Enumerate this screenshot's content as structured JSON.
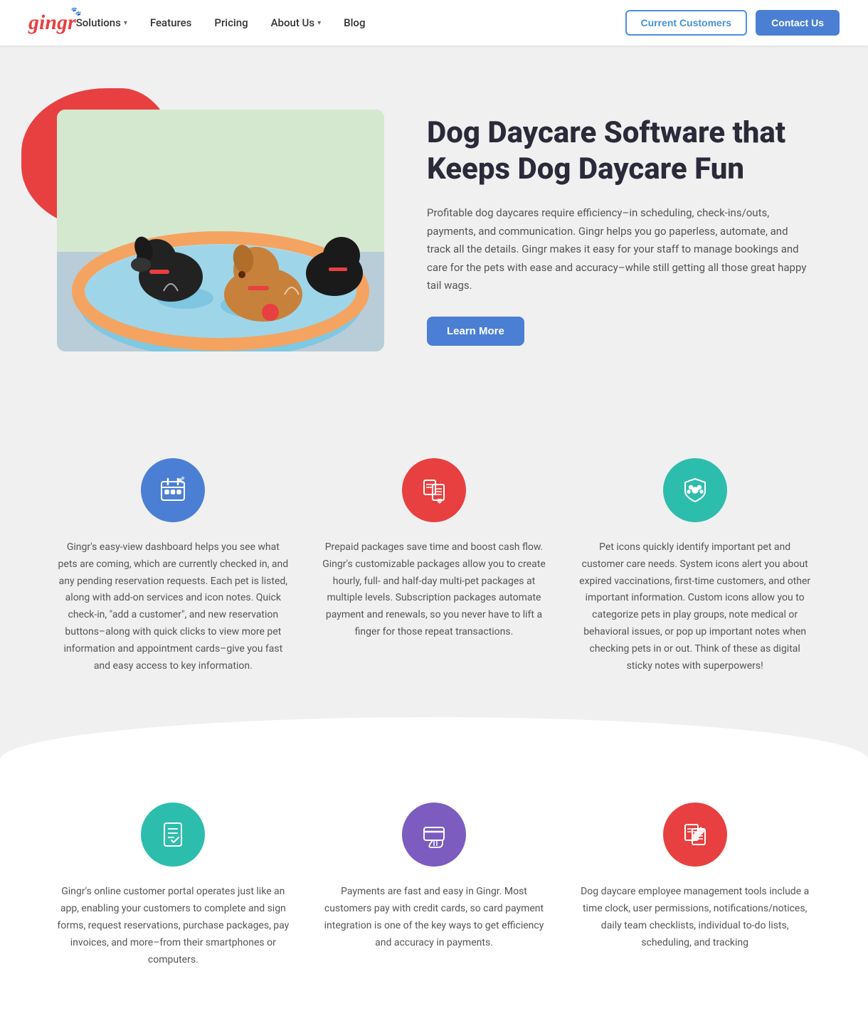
{
  "nav": {
    "logo": "gingr",
    "links": [
      {
        "label": "Solutions",
        "hasDropdown": true
      },
      {
        "label": "Features",
        "hasDropdown": false
      },
      {
        "label": "Pricing",
        "hasDropdown": false
      },
      {
        "label": "About Us",
        "hasDropdown": true
      },
      {
        "label": "Blog",
        "hasDropdown": false
      }
    ],
    "currentCustomers": "Current Customers",
    "contactUs": "Contact Us"
  },
  "hero": {
    "title": "Dog Daycare Software that Keeps Dog Daycare Fun",
    "description": "Profitable dog daycares require efficiency–in scheduling, check-ins/outs, payments, and communication. Gingr helps you go paperless, automate, and track all the details. Gingr makes it easy for your staff to manage bookings and care for the pets with ease and accuracy–while still getting all those great happy tail wags.",
    "cta": "Learn More"
  },
  "features": {
    "row1": [
      {
        "iconColor": "icon-blue",
        "iconType": "calendar",
        "description": "Gingr's easy-view dashboard helps you see what pets are coming, which are currently checked in, and any pending reservation requests. Each pet is listed, along with add-on services and icon notes. Quick check-in, \"add a customer\", and new reservation buttons–along with quick clicks to view more pet information and appointment cards–give you fast and easy access to key information."
      },
      {
        "iconColor": "icon-red",
        "iconType": "package",
        "description": "Prepaid packages save time and boost cash flow. Gingr's customizable packages allow you to create hourly, full- and half-day multi-pet packages at multiple levels. Subscription packages automate payment and renewals, so you never have to lift a finger for those repeat transactions."
      },
      {
        "iconColor": "icon-teal",
        "iconType": "shield-paw",
        "description": "Pet icons quickly identify important pet and customer care needs. System icons alert you about expired vaccinations, first-time customers, and other important information. Custom icons allow you to categorize pets in play groups, note medical or behavioral issues, or pop up important notes when checking pets in or out. Think of these as digital sticky notes with superpowers!"
      }
    ],
    "row2": [
      {
        "iconColor": "icon-teal2",
        "iconType": "document",
        "description": "Gingr's online customer portal operates just like an app, enabling your customers to complete and sign forms, request reservations, purchase packages, pay invoices, and more–from their smartphones or computers."
      },
      {
        "iconColor": "icon-purple",
        "iconType": "payment",
        "description": "Payments are fast and easy in Gingr. Most customers pay with credit cards, so card payment integration is one of the key ways to get efficiency and accuracy in payments."
      },
      {
        "iconColor": "icon-red2",
        "iconType": "employee",
        "description": "Dog daycare employee management tools include a time clock, user permissions, notifications/notices, daily team checklists, individual to-do lists, scheduling, and tracking"
      }
    ]
  }
}
